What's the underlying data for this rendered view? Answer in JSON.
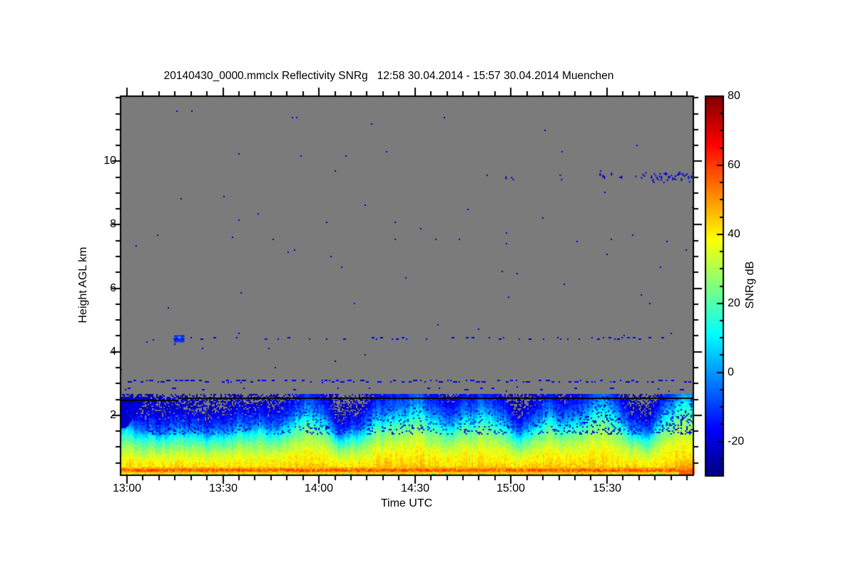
{
  "figure": {
    "title": "20140430_0000.mmclx Reflectivity SNRg   12:58 30.04.2014 - 15:57 30.04.2014 Muenchen",
    "site": "Muenchen",
    "time_start": "12:58 30.04.2014",
    "time_end": "15:57 30.04.2014"
  },
  "axes": {
    "x": {
      "label": "Time UTC",
      "tick_labels": [
        "13:00",
        "13:30",
        "14:00",
        "14:30",
        "15:00",
        "15:30"
      ]
    },
    "y": {
      "label": "Height AGL km",
      "tick_labels": [
        "10",
        "8",
        "6",
        "4",
        "2"
      ]
    },
    "colorbar": {
      "label": "SNRg dB",
      "tick_labels": [
        "80",
        "60",
        "40",
        "20",
        "0",
        "-20"
      ]
    }
  },
  "chart_data": {
    "type": "heatmap",
    "title": "20140430_0000.mmclx Reflectivity SNRg   12:58 30.04.2014 - 15:57 30.04.2014 Muenchen",
    "xlabel": "Time UTC",
    "ylabel": "Height AGL km",
    "x_range": {
      "start": "12:58",
      "end": "15:57",
      "duration_min": 179,
      "major_tick_min": 30,
      "minor_tick_min": 5,
      "major_tick_clock": [
        "13:00",
        "13:30",
        "14:00",
        "14:30",
        "15:00",
        "15:30"
      ]
    },
    "y_range": {
      "plot_min_km": 0.11,
      "plot_max_km": 12.05,
      "major_ticks_km": [
        2,
        4,
        6,
        8,
        10
      ],
      "minor_step_km": 0.5
    },
    "colorbar": {
      "label": "SNRg dB",
      "min": -30,
      "max": 80,
      "major_ticks": [
        80,
        60,
        40,
        20,
        0,
        -20
      ],
      "minor_step": 5,
      "colormap": "jet"
    },
    "no_signal_color": "#7b7b7b",
    "features": {
      "boundary_layer": {
        "base_top_km": 1.42,
        "profile_km_db": [
          [
            0.11,
            47
          ],
          [
            0.35,
            43
          ],
          [
            0.6,
            38
          ],
          [
            0.85,
            31
          ],
          [
            1.05,
            24
          ],
          [
            1.25,
            16
          ],
          [
            1.42,
            6
          ],
          [
            1.6,
            -4
          ],
          [
            1.9,
            -14
          ],
          [
            2.2,
            -22
          ],
          [
            2.6,
            -27
          ]
        ],
        "plumes": [
          {
            "t": 56,
            "amp": 0.45,
            "w": 4
          },
          {
            "t": 62,
            "amp": 0.35,
            "w": 3
          },
          {
            "t": 84,
            "amp": 0.5,
            "w": 5
          },
          {
            "t": 93,
            "amp": 0.6,
            "w": 4
          },
          {
            "t": 108,
            "amp": 0.45,
            "w": 5
          },
          {
            "t": 116,
            "amp": 0.4,
            "w": 4
          },
          {
            "t": 132,
            "amp": 0.35,
            "w": 3
          },
          {
            "t": 146,
            "amp": 0.5,
            "w": 6
          },
          {
            "t": 152,
            "amp": 0.45,
            "w": 4
          },
          {
            "t": 171,
            "amp": 0.5,
            "w": 4
          },
          {
            "t": 177,
            "amp": 0.95,
            "w": 3
          }
        ]
      },
      "surface_echo": {
        "height_km": 0.28,
        "db_min": 50,
        "db_max": 64
      },
      "sub_surface_band": {
        "db_min": 38,
        "db_max": 48
      },
      "corner_blob": {
        "t_start_min": 174.5,
        "db_min": 42,
        "db_max": 62
      },
      "black_line": {
        "left_km": 2.48,
        "right_km": 2.55,
        "step_t_min": 18
      },
      "insect_rows": [
        {
          "km": 3.05,
          "density": 0.35,
          "db": [
            -25,
            -15
          ]
        },
        {
          "km": 2.85,
          "density": 0.045,
          "db": [
            -25,
            -16
          ]
        },
        {
          "km": 4.4,
          "density": 0.1,
          "db": [
            -25,
            -15
          ],
          "dense_spans": [
            [
              58,
              118,
              0.2
            ],
            [
              118,
              172,
              0.26
            ]
          ],
          "blob": {
            "t0": 16.8,
            "t1": 19.8,
            "km0": 4.32,
            "km1": 4.52,
            "db": [
              -20,
              -7
            ]
          }
        }
      ],
      "cloud_streak": {
        "km0": 9.42,
        "km1": 9.66,
        "t_sparse": 118,
        "t_main": 145,
        "t_end": 179,
        "db": [
          -26,
          -17
        ]
      },
      "noise_speckle": {
        "density": 0.0021,
        "db": [
          -26,
          -16
        ]
      },
      "midlevel_speckle": {
        "km0": 1.55,
        "km1": 2.45,
        "db": [
          -26,
          -13
        ],
        "clusters": [
          [
            8,
            25,
            0.3
          ],
          [
            25,
            56,
            0.18
          ],
          [
            56,
            78,
            0.26
          ],
          [
            78,
            98,
            0.2
          ],
          [
            98,
            118,
            0.16
          ],
          [
            118,
            138,
            0.18
          ],
          [
            138,
            158,
            0.26
          ],
          [
            158,
            175,
            0.24
          ],
          [
            175,
            179,
            0.4
          ]
        ]
      },
      "left_wedge": {
        "t0": 0,
        "t1": 8,
        "km0": 1.55,
        "km1": 2.45
      }
    }
  }
}
